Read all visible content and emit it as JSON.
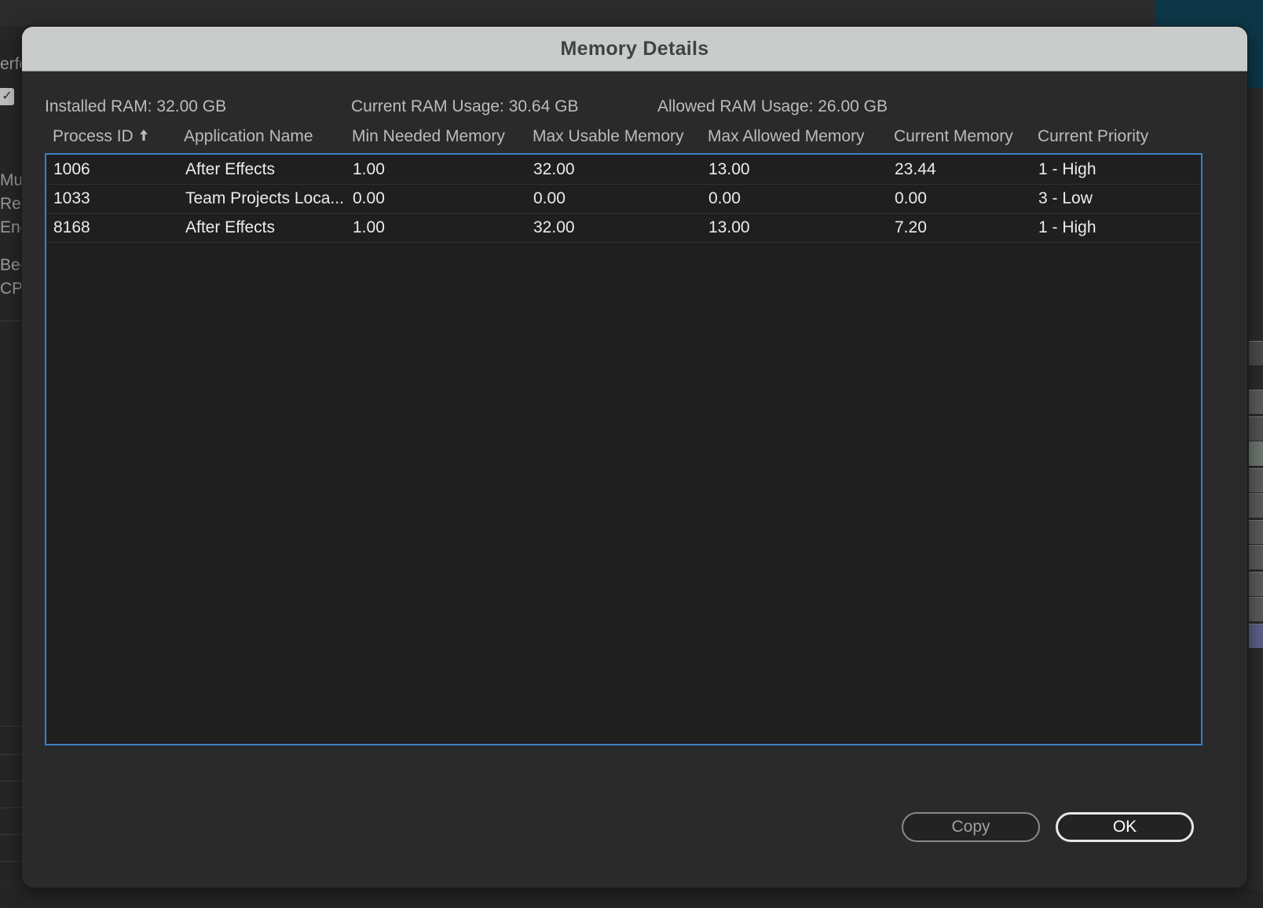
{
  "background": {
    "left_fragments": [
      "erfo",
      "Mul",
      "Ren",
      "Enc",
      "Bec",
      "CPU"
    ]
  },
  "dialog": {
    "title": "Memory Details",
    "summary": {
      "installed_ram": "Installed RAM: 32.00 GB",
      "current_ram_usage": "Current RAM Usage: 30.64 GB",
      "allowed_ram_usage": "Allowed RAM Usage: 26.00 GB"
    },
    "table": {
      "columns": [
        "Process ID",
        "Application Name",
        "Min Needed Memory",
        "Max Usable Memory",
        "Max Allowed Memory",
        "Current Memory",
        "Current Priority"
      ],
      "sort_column": "Process ID",
      "sort_direction": "ascending",
      "rows": [
        [
          "1006",
          "After Effects",
          "1.00",
          "32.00",
          "13.00",
          "23.44",
          "1 - High"
        ],
        [
          "1033",
          "Team Projects Loca...",
          "0.00",
          "0.00",
          "0.00",
          "0.00",
          "3 - Low"
        ],
        [
          "8168",
          "After Effects",
          "1.00",
          "32.00",
          "13.00",
          "7.20",
          "1 - High"
        ]
      ]
    },
    "buttons": {
      "copy_label": "Copy",
      "ok_label": "OK"
    }
  },
  "colors": {
    "accent_border": "#3d7fc9",
    "title_bar": "#c9cccb",
    "dialog_bg": "#2a2a2a",
    "table_bg": "#1f1f1f"
  }
}
